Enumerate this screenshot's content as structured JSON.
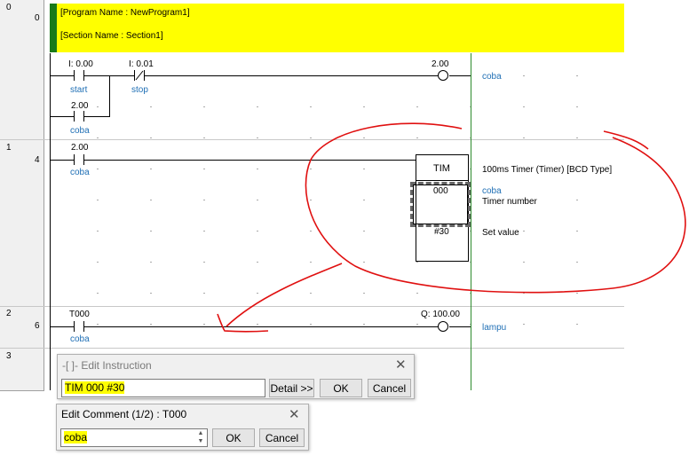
{
  "rungs": [
    {
      "number": "0",
      "step": "0"
    },
    {
      "number": "1",
      "step": "4"
    },
    {
      "number": "2",
      "step": "6"
    },
    {
      "number": "3",
      "step": ""
    }
  ],
  "header": {
    "program_name": "[Program Name : NewProgram1]",
    "section_name": "[Section Name : Section1]",
    "bg_color": "#ffff00",
    "bar_color": "#1a7a1a"
  },
  "rung0": {
    "contact_start": {
      "address": "I: 0.00",
      "comment": "start"
    },
    "contact_stop": {
      "address": "I: 0.01",
      "comment": "stop"
    },
    "contact_coba": {
      "address": "2.00",
      "comment": "coba"
    },
    "coil": {
      "address": "2.00",
      "comment": "coba"
    }
  },
  "rung1": {
    "contact": {
      "address": "2.00",
      "comment": "coba"
    },
    "timer": {
      "mnemonic": "TIM",
      "description": "100ms Timer (Timer) [BCD Type]",
      "operand1": "000",
      "operand1_comment": "coba",
      "operand1_label": "Timer number",
      "operand2": "#30",
      "operand2_label": "Set value"
    }
  },
  "rung2": {
    "contact": {
      "address": "T000",
      "comment": "coba"
    },
    "coil": {
      "address": "Q: 100.00",
      "comment": "lampu"
    }
  },
  "edit_instruction": {
    "title": "-[ ]- Edit Instruction",
    "value": "TIM 000 #30",
    "detail_label": "Detail >>",
    "ok_label": "OK",
    "cancel_label": "Cancel"
  },
  "edit_comment": {
    "title": "Edit Comment (1/2) : T000",
    "value": "coba",
    "ok_label": "OK",
    "cancel_label": "Cancel"
  },
  "colors": {
    "comment": "#1f6fb5",
    "annotation": "#e01010",
    "highlight": "#ffff00",
    "power_rail": "#2e8b2e"
  }
}
